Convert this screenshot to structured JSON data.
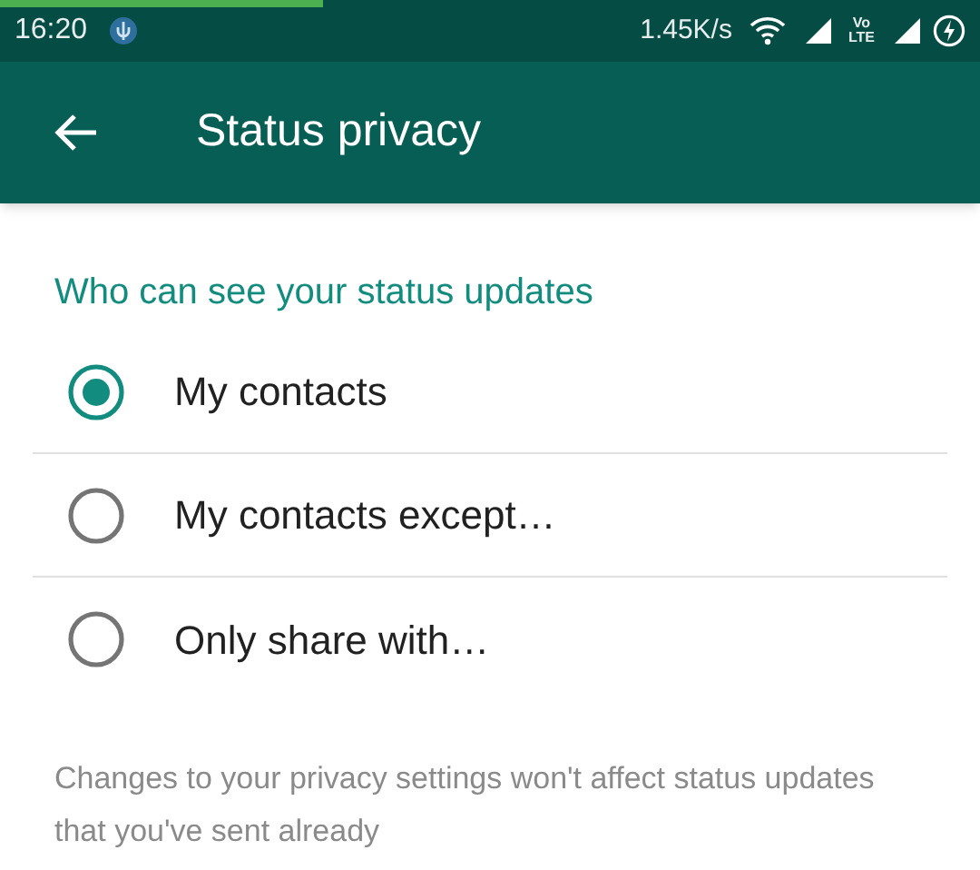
{
  "status_bar": {
    "time": "16:20",
    "speed": "1.45K/s",
    "volte": [
      "Vo",
      "LTE"
    ],
    "loading": {
      "level": 0.33
    }
  },
  "app_bar": {
    "title": "Status privacy"
  },
  "section": {
    "heading": "Who can see your status updates"
  },
  "options": [
    {
      "label": "My contacts",
      "selected": true
    },
    {
      "label": "My contacts except…",
      "selected": false
    },
    {
      "label": "Only share with…",
      "selected": false
    }
  ],
  "note": "Changes to your privacy settings won't affect status updates that you've sent already"
}
